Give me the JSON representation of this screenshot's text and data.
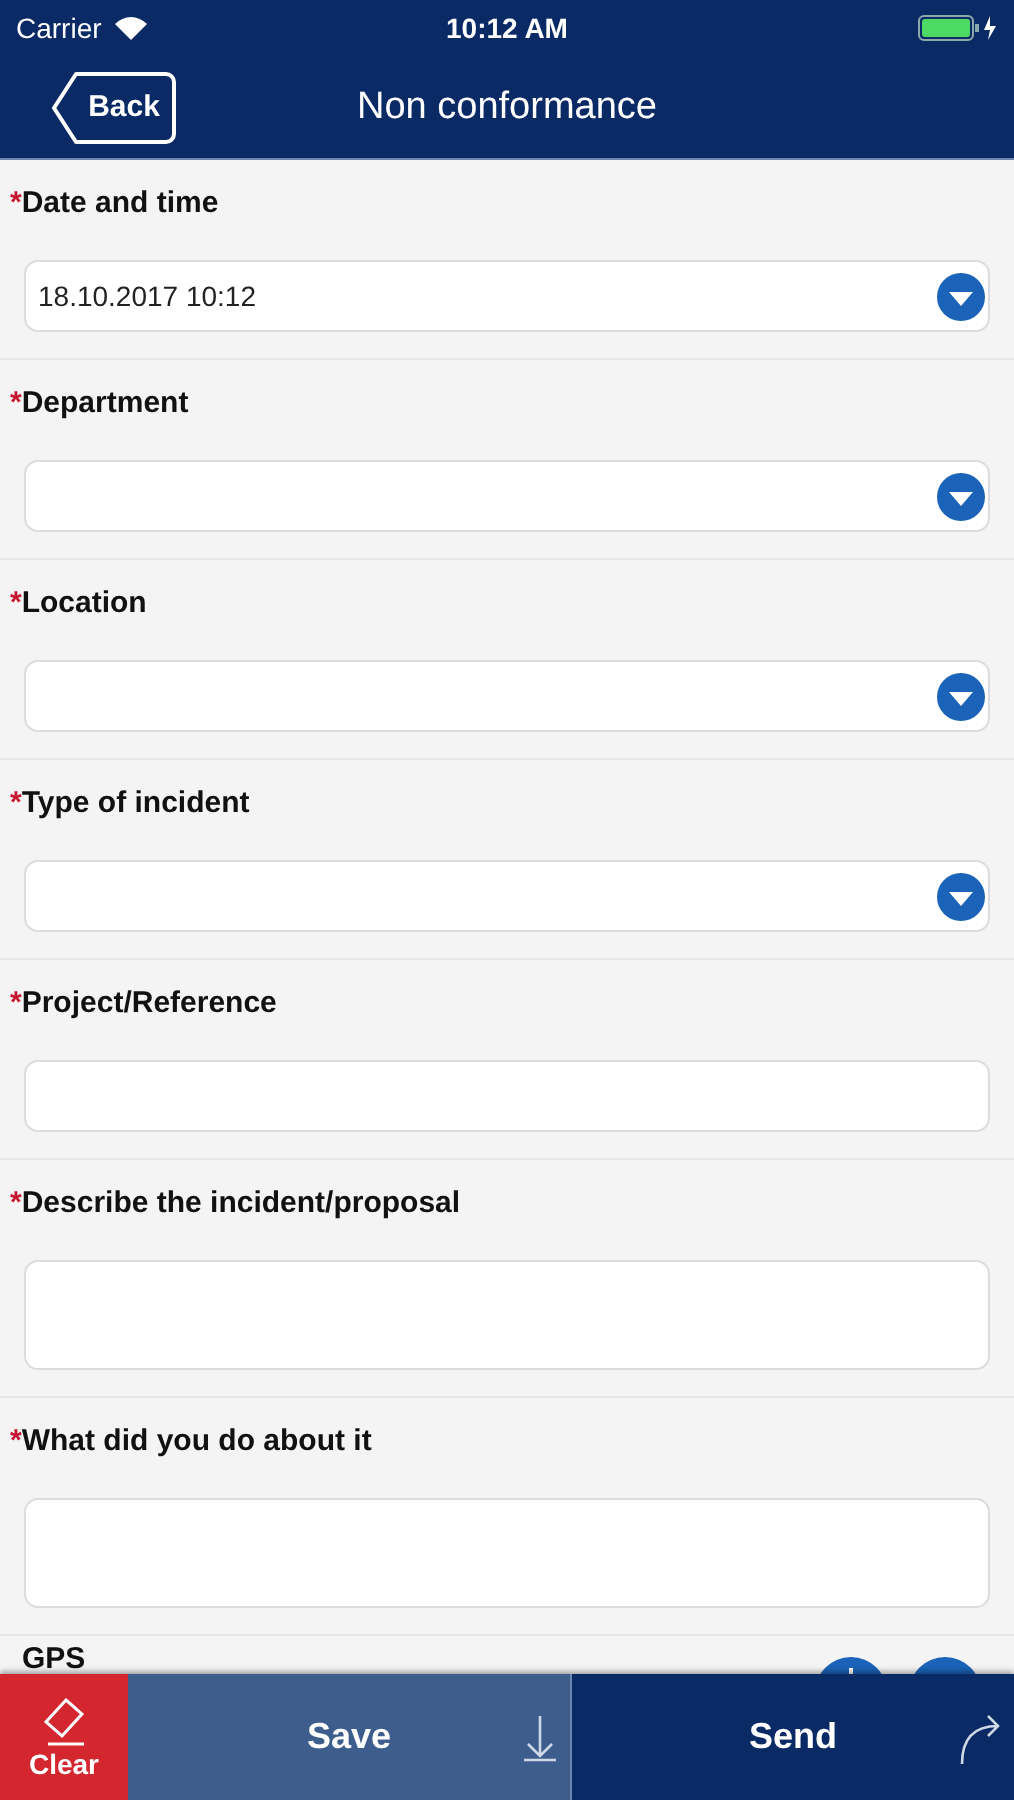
{
  "status_bar": {
    "carrier": "Carrier",
    "time": "10:12 AM"
  },
  "nav": {
    "back": "Back",
    "title": "Non conformance"
  },
  "fields": [
    {
      "kind": "select",
      "marker": "*",
      "label": "Date and time",
      "value": "18.10.2017 10:12"
    },
    {
      "kind": "select",
      "marker": "*",
      "label": "Department"
    },
    {
      "kind": "select",
      "marker": "*",
      "label": "Location"
    },
    {
      "kind": "select",
      "marker": "*",
      "label": "Type of incident"
    },
    {
      "kind": "text",
      "marker": "*",
      "label": "Project/Reference"
    },
    {
      "kind": "textarea",
      "marker": "*",
      "label": "Describe the incident/proposal"
    },
    {
      "kind": "textarea",
      "marker": "*",
      "label": "What did you do about it"
    },
    {
      "kind": "gps",
      "label": "GPS"
    }
  ],
  "footer": [
    {
      "kind": "clear",
      "label": "Clear"
    },
    {
      "kind": "save",
      "label": "Save"
    },
    {
      "kind": "send",
      "label": "Send"
    }
  ]
}
